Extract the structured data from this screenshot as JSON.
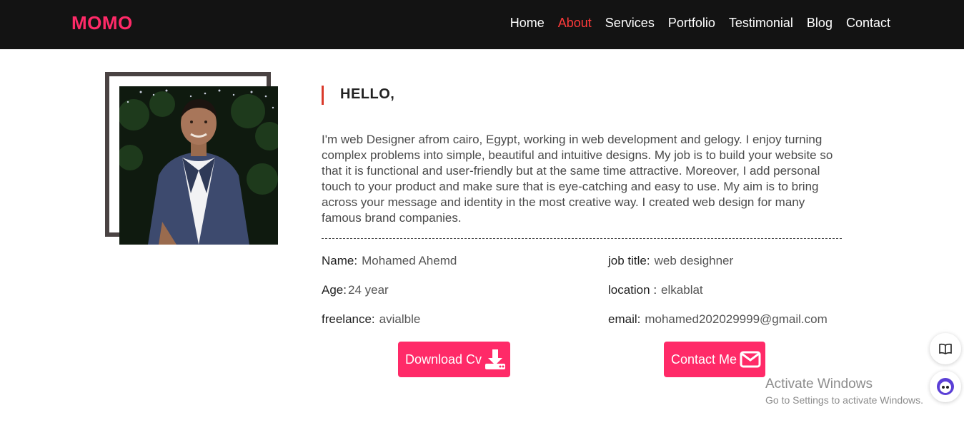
{
  "brand": {
    "logo": "MOMO",
    "accent_color": "#ff2a68"
  },
  "nav": {
    "items": [
      {
        "label": "Home",
        "active": false
      },
      {
        "label": "About",
        "active": true
      },
      {
        "label": "Services",
        "active": false
      },
      {
        "label": "Portfolio",
        "active": false
      },
      {
        "label": "Testimonial",
        "active": false
      },
      {
        "label": "Blog",
        "active": false
      },
      {
        "label": "Contact",
        "active": false
      }
    ],
    "active_color": "#ff3a3a"
  },
  "about": {
    "heading": "HELLO,",
    "bio": "I'm web Designer afrom cairo, Egypt, working in web development and gelogy. I enjoy turning complex problems into simple, beautiful and intuitive designs. My job is to build your website so that it is functional and user-friendly but at the same time attractive. Moreover, I add personal touch to your product and make sure that is eye-catching and easy to use. My aim is to bring across your message and identity in the most creative way. I created web design for many famous brand companies.",
    "photo_icon": "profile-photo",
    "info": {
      "name_label": "Name:",
      "name_value": "Mohamed Ahemd",
      "age_label": "Age:",
      "age_value": "24 year",
      "freelance_label": "freelance:",
      "freelance_value": "avialble",
      "job_label": "job title:",
      "job_value": "web desighner",
      "location_label": "location :",
      "location_value": "elkablat",
      "email_label": "email:",
      "email_value": "mohamed202029999@gmail.com"
    },
    "buttons": {
      "download_label": "Download Cv",
      "download_icon": "download-icon",
      "contact_label": "Contact Me",
      "contact_icon": "envelope-icon"
    }
  },
  "overlay": {
    "activate_title": "Activate Windows",
    "activate_sub": "Go to Settings to activate Windows.",
    "float_icons": [
      "book-icon",
      "assistant-face-icon"
    ]
  }
}
